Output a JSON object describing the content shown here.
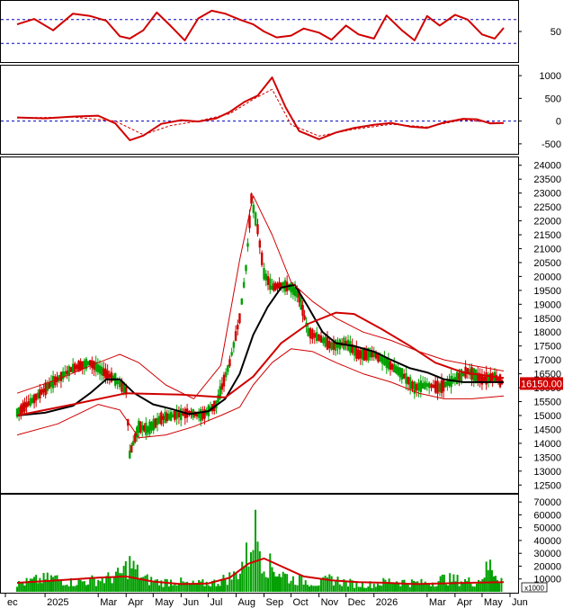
{
  "chart_data": [
    {
      "type": "line",
      "panel": "RSI oscillator",
      "yticks": [
        50
      ],
      "ylim": [
        0,
        100
      ],
      "reference_lines": [
        70,
        30
      ],
      "series": [
        {
          "color": "#d00000",
          "x": [
            "2024-12-01",
            "2024-12-20",
            "2025-01-10",
            "2025-02-01",
            "2025-02-20",
            "2025-03-10",
            "2025-03-25",
            "2025-04-05",
            "2025-04-20",
            "2025-05-05",
            "2025-05-20",
            "2025-06-05",
            "2025-06-20",
            "2025-07-05",
            "2025-07-20",
            "2025-08-05",
            "2025-08-20",
            "2025-09-01",
            "2025-09-15",
            "2025-10-01",
            "2025-10-15",
            "2025-11-01",
            "2025-11-15",
            "2025-12-01",
            "2025-12-15",
            "2026-01-01",
            "2026-01-15",
            "2026-02-01",
            "2026-02-15",
            "2026-03-01",
            "2026-03-15",
            "2026-04-01",
            "2026-04-15",
            "2026-05-01",
            "2026-05-15",
            "2026-05-25"
          ],
          "values": [
            62,
            71,
            52,
            80,
            76,
            68,
            42,
            38,
            52,
            82,
            60,
            35,
            72,
            85,
            80,
            70,
            62,
            50,
            40,
            43,
            55,
            48,
            36,
            60,
            45,
            38,
            77,
            52,
            35,
            76,
            60,
            78,
            70,
            45,
            38,
            56
          ]
        }
      ]
    },
    {
      "type": "line",
      "panel": "MACD",
      "yticks": [
        1000,
        500,
        0,
        -500
      ],
      "ylim": [
        -700,
        1200
      ],
      "reference_lines": [
        0
      ],
      "series": [
        {
          "color": "#d00000",
          "x": [
            "2024-12-01",
            "2025-01-01",
            "2025-02-01",
            "2025-03-01",
            "2025-03-20",
            "2025-04-05",
            "2025-04-20",
            "2025-05-10",
            "2025-06-01",
            "2025-06-20",
            "2025-07-10",
            "2025-07-25",
            "2025-08-10",
            "2025-08-25",
            "2025-09-10",
            "2025-09-25",
            "2025-10-10",
            "2025-11-01",
            "2025-11-20",
            "2025-12-10",
            "2026-01-01",
            "2026-01-20",
            "2026-02-10",
            "2026-03-01",
            "2026-03-20",
            "2026-04-10",
            "2026-04-25",
            "2026-05-10",
            "2026-05-25"
          ],
          "values": [
            80,
            60,
            100,
            120,
            -50,
            -420,
            -320,
            -60,
            20,
            -10,
            60,
            200,
            420,
            560,
            960,
            300,
            -220,
            -400,
            -250,
            -150,
            -80,
            -40,
            -120,
            -150,
            -30,
            50,
            40,
            -50,
            -40
          ]
        },
        {
          "color": "#d00000",
          "dashed": true,
          "x": [
            "2024-12-01",
            "2025-02-01",
            "2025-03-20",
            "2025-04-20",
            "2025-05-20",
            "2025-06-20",
            "2025-07-25",
            "2025-08-20",
            "2025-09-10",
            "2025-10-01",
            "2025-11-01",
            "2025-12-10",
            "2026-01-20",
            "2026-03-01",
            "2026-04-10",
            "2026-05-10",
            "2026-05-25"
          ],
          "values": [
            70,
            90,
            0,
            -300,
            -100,
            0,
            160,
            480,
            700,
            -80,
            -330,
            -180,
            -70,
            -130,
            30,
            -30,
            -40
          ]
        }
      ]
    },
    {
      "type": "candlestick",
      "panel": "Price",
      "yticks": [
        24000,
        23500,
        23000,
        22500,
        22000,
        21500,
        21000,
        20500,
        20000,
        19500,
        19000,
        18500,
        18000,
        17500,
        17000,
        16500,
        16000,
        15500,
        15000,
        14500,
        14000,
        13500,
        13000,
        12500
      ],
      "ylim": [
        12250,
        24250
      ],
      "last_price_label": "16150.00",
      "x_categories": [
        "ec",
        "2025",
        "Mar",
        "Apr",
        "May",
        "Jun",
        "Jul",
        "Aug",
        "Sep",
        "Oct",
        "Nov",
        "Dec",
        "2026",
        "Mar",
        "Apr",
        "May",
        "Jun"
      ],
      "series": [
        {
          "name": "",
          "color": "#000000",
          "x": [
            "2024-12-01",
            "2025-01-01",
            "2025-02-01",
            "2025-02-20",
            "2025-03-10",
            "2025-03-25",
            "2025-04-10",
            "2025-05-01",
            "2025-05-20",
            "2025-06-10",
            "2025-07-01",
            "2025-07-20",
            "2025-08-05",
            "2025-08-20",
            "2025-09-05",
            "2025-09-20",
            "2025-10-05",
            "2025-10-20",
            "2025-11-05",
            "2025-11-20",
            "2025-12-10",
            "2026-01-01",
            "2026-01-20",
            "2026-02-10",
            "2026-03-01",
            "2026-03-20",
            "2026-04-10",
            "2026-05-01",
            "2026-05-25"
          ],
          "values": [
            15000,
            15100,
            15350,
            15800,
            16300,
            16300,
            15800,
            15400,
            15250,
            15050,
            15150,
            15600,
            16500,
            17900,
            18900,
            19600,
            19700,
            18900,
            18000,
            17600,
            17500,
            17300,
            17000,
            16700,
            16550,
            16300,
            16200,
            16200,
            16200
          ]
        },
        {
          "name": "",
          "color": "#d00000",
          "x": [
            "2024-12-01",
            "2025-02-01",
            "2025-04-01",
            "2025-06-01",
            "2025-07-20",
            "2025-08-20",
            "2025-09-20",
            "2025-10-20",
            "2025-11-20",
            "2025-12-10",
            "2026-01-10",
            "2026-02-10",
            "2026-03-10",
            "2026-04-10",
            "2026-05-25"
          ],
          "values": [
            15000,
            15400,
            15800,
            15750,
            15650,
            16400,
            17600,
            18300,
            18700,
            18650,
            18100,
            17500,
            16900,
            16550,
            16350
          ]
        },
        {
          "name": "",
          "color": "#d00000",
          "thin": true,
          "x": [
            "2024-12-01",
            "2025-01-15",
            "2025-03-01",
            "2025-03-25",
            "2025-04-15",
            "2025-05-15",
            "2025-06-15",
            "2025-07-15",
            "2025-08-05",
            "2025-08-20",
            "2025-09-10",
            "2025-10-01",
            "2025-10-25",
            "2025-11-20",
            "2025-12-20",
            "2026-01-20",
            "2026-02-20",
            "2026-03-20",
            "2026-04-20",
            "2026-05-25"
          ],
          "values": [
            15800,
            16300,
            16900,
            17200,
            16900,
            16100,
            15600,
            16800,
            20600,
            22900,
            21500,
            19800,
            19100,
            18500,
            18000,
            17700,
            17300,
            17000,
            16800,
            16600
          ]
        },
        {
          "name": "",
          "color": "#d00000",
          "thin": true,
          "x": [
            "2024-12-01",
            "2025-01-15",
            "2025-03-01",
            "2025-03-25",
            "2025-04-15",
            "2025-05-15",
            "2025-06-15",
            "2025-07-15",
            "2025-08-05",
            "2025-08-20",
            "2025-09-10",
            "2025-10-01",
            "2025-10-25",
            "2025-11-20",
            "2025-12-20",
            "2026-01-20",
            "2026-02-20",
            "2026-03-20",
            "2026-04-20",
            "2026-05-25"
          ],
          "values": [
            14300,
            14700,
            15400,
            15200,
            14200,
            14300,
            14600,
            15000,
            15300,
            16100,
            16900,
            17400,
            17300,
            16900,
            16500,
            16200,
            15800,
            15600,
            15600,
            15700
          ]
        }
      ],
      "price_path": {
        "x": [
          "2024-12-01",
          "2024-12-20",
          "2025-01-10",
          "2025-02-01",
          "2025-02-20",
          "2025-03-05",
          "2025-03-20",
          "2025-04-01",
          "2025-04-05",
          "2025-04-15",
          "2025-04-25",
          "2025-05-10",
          "2025-05-25",
          "2025-06-10",
          "2025-06-25",
          "2025-07-10",
          "2025-07-25",
          "2025-08-05",
          "2025-08-12",
          "2025-08-18",
          "2025-08-25",
          "2025-09-01",
          "2025-09-10",
          "2025-09-20",
          "2025-10-01",
          "2025-10-10",
          "2025-10-20",
          "2025-11-01",
          "2025-11-15",
          "2025-12-01",
          "2025-12-15",
          "2026-01-01",
          "2026-01-15",
          "2026-02-01",
          "2026-02-15",
          "2026-03-01",
          "2026-03-15",
          "2026-04-01",
          "2026-04-15",
          "2026-05-01",
          "2026-05-15",
          "2026-05-25"
        ],
        "values": [
          15100,
          15600,
          16200,
          16700,
          16900,
          16600,
          16300,
          15900,
          13600,
          14600,
          14500,
          14900,
          15000,
          15100,
          15000,
          15400,
          16900,
          18500,
          20300,
          22800,
          21700,
          20100,
          19600,
          19700,
          19600,
          19300,
          18000,
          17800,
          17500,
          17600,
          17200,
          17200,
          16900,
          16500,
          16000,
          16100,
          16000,
          16300,
          16600,
          16300,
          16400,
          16150
        ]
      }
    },
    {
      "type": "bar",
      "panel": "Volume",
      "yticks": [
        70000,
        60000,
        50000,
        40000,
        30000,
        20000,
        10000
      ],
      "ylim": [
        0,
        75000
      ],
      "unit_label": "x1000",
      "bar_color": "#00a000",
      "series": [
        {
          "name": "",
          "color": "#d00000",
          "x": [
            "2024-12-01",
            "2025-01-15",
            "2025-03-01",
            "2025-04-01",
            "2025-05-01",
            "2025-06-01",
            "2025-07-01",
            "2025-07-25",
            "2025-08-15",
            "2025-09-01",
            "2025-09-20",
            "2025-10-15",
            "2025-11-15",
            "2025-12-15",
            "2026-01-15",
            "2026-02-15",
            "2026-03-15",
            "2026-04-15",
            "2026-05-25"
          ],
          "values": [
            7000,
            9000,
            11000,
            12000,
            8000,
            6000,
            6500,
            11000,
            22000,
            26000,
            20000,
            12000,
            9000,
            7500,
            7000,
            6000,
            6500,
            7000,
            7500
          ]
        }
      ],
      "volume_bars": {
        "x": [
          "2024-12-01",
          "2024-12-20",
          "2025-01-10",
          "2025-02-01",
          "2025-02-20",
          "2025-03-10",
          "2025-03-25",
          "2025-04-05",
          "2025-04-20",
          "2025-05-10",
          "2025-05-25",
          "2025-06-10",
          "2025-06-25",
          "2025-07-10",
          "2025-07-20",
          "2025-08-01",
          "2025-08-10",
          "2025-08-15",
          "2025-08-20",
          "2025-08-25",
          "2025-09-01",
          "2025-09-10",
          "2025-09-20",
          "2025-10-01",
          "2025-10-15",
          "2025-11-01",
          "2025-11-15",
          "2025-12-01",
          "2025-12-15",
          "2026-01-01",
          "2026-01-20",
          "2026-02-10",
          "2026-03-01",
          "2026-03-20",
          "2026-04-10",
          "2026-04-25",
          "2026-05-10",
          "2026-05-20",
          "2026-05-25"
        ],
        "values": [
          8000,
          12000,
          15000,
          10000,
          12000,
          14000,
          18000,
          30000,
          14000,
          10000,
          12000,
          8000,
          9000,
          10000,
          14000,
          18000,
          34000,
          40000,
          70000,
          58000,
          32000,
          26000,
          20000,
          14000,
          12000,
          9000,
          14000,
          10000,
          8000,
          8000,
          12000,
          10000,
          9000,
          14000,
          12000,
          10000,
          28000,
          16000,
          14000
        ]
      }
    }
  ]
}
